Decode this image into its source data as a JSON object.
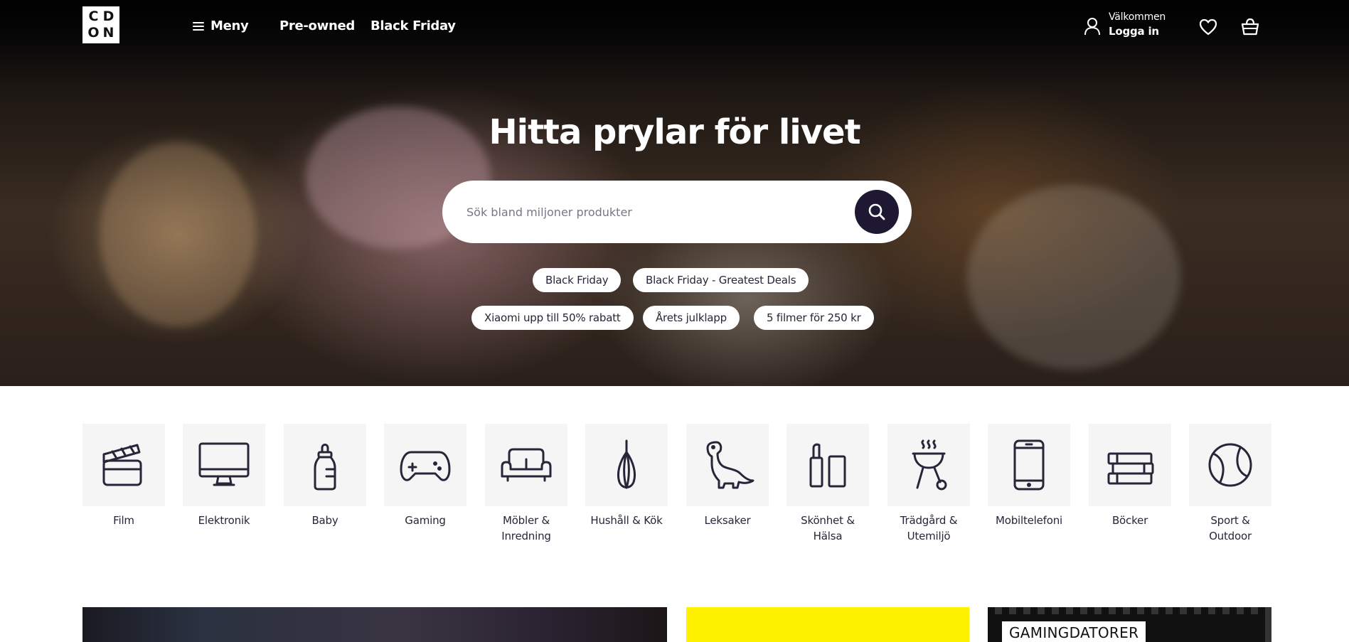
{
  "brand": {
    "logo_letters": [
      "C",
      "D",
      "O",
      "N"
    ]
  },
  "header": {
    "menu_label": "Meny",
    "nav": [
      "Pre-owned",
      "Black Friday"
    ],
    "user": {
      "greeting": "Välkommen",
      "login": "Logga in"
    },
    "icons": [
      "menu-icon",
      "user-icon",
      "heart-icon",
      "basket-icon"
    ]
  },
  "hero": {
    "title": "Hitta prylar för livet",
    "search": {
      "placeholder": "Sök bland miljoner produkter",
      "value": ""
    },
    "chips": [
      "Black Friday",
      "Black Friday - Greatest Deals",
      "Xiaomi upp till 50% rabatt",
      "Årets julklapp",
      "5 filmer för 250 kr"
    ]
  },
  "categories": [
    {
      "label": "Film",
      "icon": "clapperboard-icon"
    },
    {
      "label": "Elektronik",
      "icon": "monitor-icon"
    },
    {
      "label": "Baby",
      "icon": "baby-bottle-icon"
    },
    {
      "label": "Gaming",
      "icon": "gamepad-icon"
    },
    {
      "label": "Möbler & Inredning",
      "icon": "sofa-icon"
    },
    {
      "label": "Hushåll & Kök",
      "icon": "whisk-icon"
    },
    {
      "label": "Leksaker",
      "icon": "dinosaur-icon"
    },
    {
      "label": "Skönhet & Hälsa",
      "icon": "cosmetics-icon"
    },
    {
      "label": "Trädgård & Utemiljö",
      "icon": "grill-icon"
    },
    {
      "label": "Mobiltelefoni",
      "icon": "mobile-phone-icon"
    },
    {
      "label": "Böcker",
      "icon": "books-icon"
    },
    {
      "label": "Sport & Outdoor",
      "icon": "tennis-ball-icon"
    }
  ],
  "banners": {
    "gaming_tag": "GAMINGDATORER"
  },
  "colors": {
    "search_button": "#1e1833",
    "category_bg": "#f5f5f6",
    "banner_yellow": "#fff200",
    "text": "#2a2438"
  }
}
